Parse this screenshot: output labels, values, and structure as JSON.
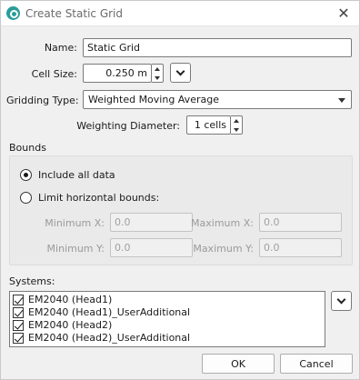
{
  "window": {
    "title": "Create Static Grid",
    "app_icon": "qimera-app-icon",
    "close_glyph": "✕"
  },
  "form": {
    "name_label": "Name:",
    "name_value": "Static Grid",
    "cell_size_label": "Cell Size:",
    "cell_size_value": "0.250 m",
    "gridding_type_label": "Gridding Type:",
    "gridding_type_value": "Weighted Moving Average",
    "weighting_diameter_label": "Weighting Diameter:",
    "weighting_diameter_value": "1 cells"
  },
  "bounds": {
    "section_label": "Bounds",
    "include_all_label": "Include all data",
    "include_all_selected": true,
    "limit_label": "Limit horizontal bounds:",
    "limit_selected": false,
    "min_x_label": "Minimum X:",
    "min_x_value": "0.0",
    "max_x_label": "Maximum X:",
    "max_x_value": "0.0",
    "min_y_label": "Minimum Y:",
    "min_y_value": "0.0",
    "max_y_label": "Maximum Y:",
    "max_y_value": "0.0"
  },
  "systems": {
    "section_label": "Systems:",
    "items": [
      {
        "label": "EM2040 (Head1)",
        "checked": true
      },
      {
        "label": "EM2040 (Head1)_UserAdditional",
        "checked": true
      },
      {
        "label": "EM2040 (Head2)",
        "checked": true
      },
      {
        "label": "EM2040 (Head2)_UserAdditional",
        "checked": true
      }
    ]
  },
  "buttons": {
    "ok_label": "OK",
    "cancel_label": "Cancel"
  }
}
